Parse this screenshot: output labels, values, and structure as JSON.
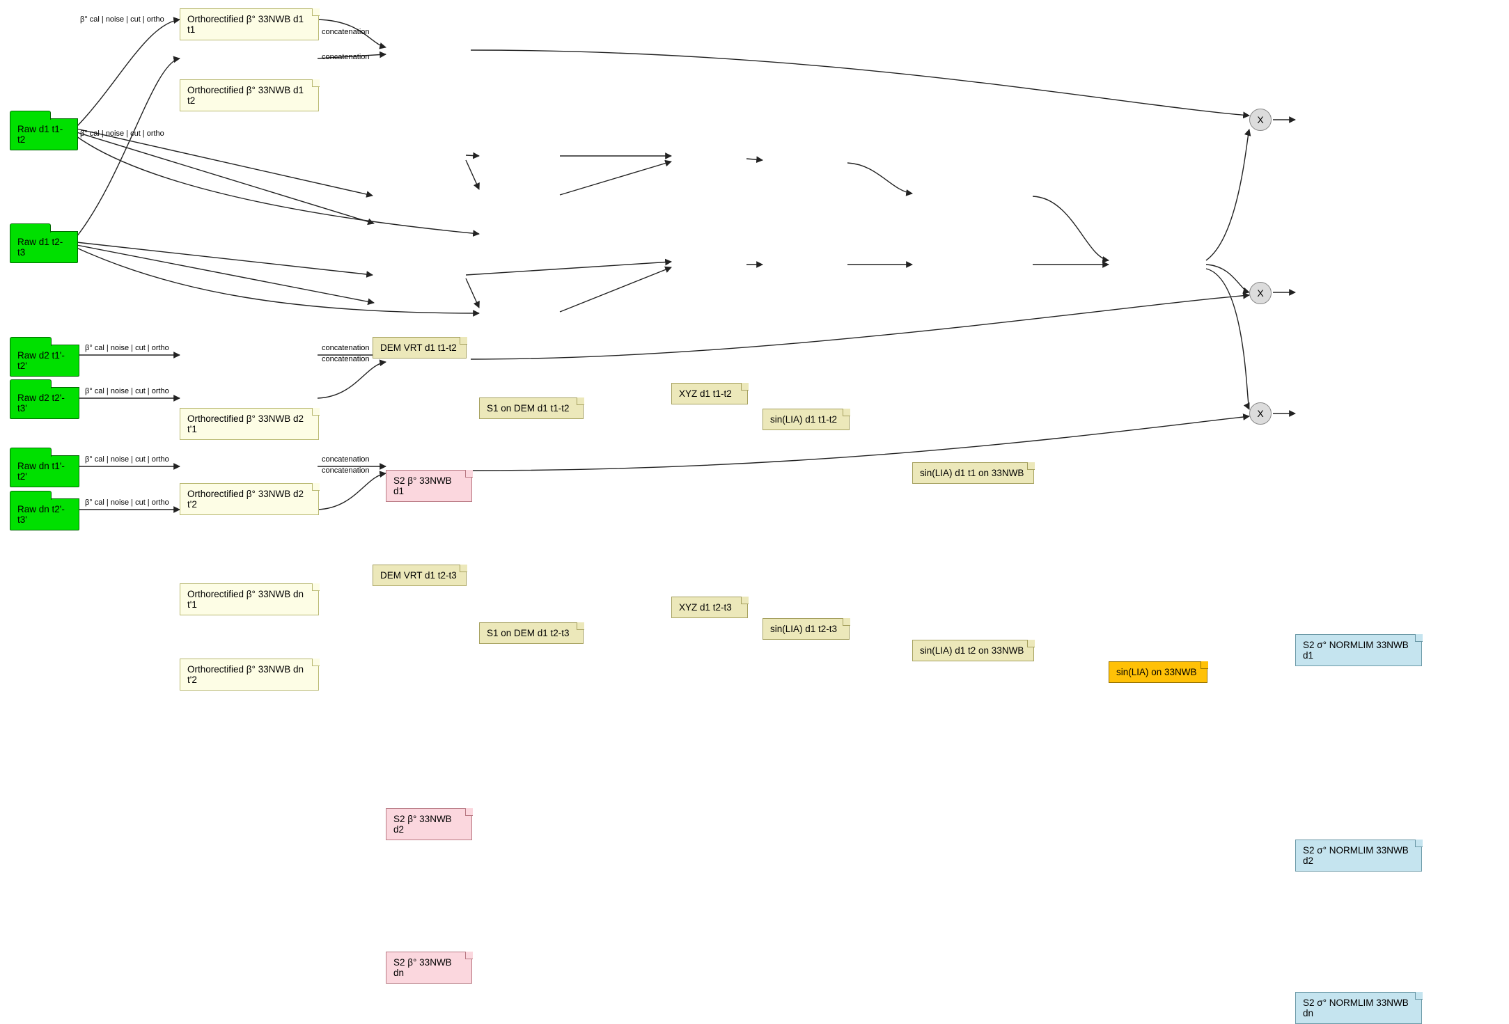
{
  "folders": {
    "raw_d1_t1t2": "Raw d1 t1-t2",
    "raw_d1_t2t3": "Raw d1 t2-t3",
    "raw_d2_t1t2": "Raw d2 t1'-t2'",
    "raw_d2_t2t3": "Raw d2 t2'-t3'",
    "raw_dn_t1t2": "Raw dn t1'-t2'",
    "raw_dn_t2t3": "Raw dn t2'-t3'"
  },
  "notes": {
    "ortho_d1_t1": "Orthorectified β° 33NWB d1 t1",
    "ortho_d1_t2": "Orthorectified β° 33NWB d1 t2",
    "dem_vrt_d1": "DEM VRT d1 t1-t2",
    "s1dem_d1": "S1 on DEM d1 t1-t2",
    "xyz_d1": "XYZ d1 t1-t2",
    "sinlia_d1": "sin(LIA) d1 t1-t2",
    "sinlia_d1_on": "sin(LIA) d1 t1 on 33NWB",
    "dem_vrt_d1b": "DEM VRT d1 t2-t3",
    "s1dem_d1b": "S1 on DEM d1 t2-t3",
    "xyz_d1b": "XYZ d1 t2-t3",
    "sinlia_d1b": "sin(LIA) d1 t2-t3",
    "sinlia_d1b_on": "sin(LIA) d1 t2 on 33NWB",
    "sinlia_gold": "sin(LIA) on 33NWB",
    "s2_d1": "S2 β° 33NWB d1",
    "ortho_d2_t1": "Orthorectified β° 33NWB d2 t'1",
    "ortho_d2_t2": "Orthorectified β° 33NWB d2 t'2",
    "s2_d2": "S2 β° 33NWB d2",
    "ortho_dn_t1": "Orthorectified β° 33NWB dn t'1",
    "ortho_dn_t2": "Orthorectified β° 33NWB dn t'2",
    "s2_dn": "S2 β° 33NWB dn",
    "out_d1": "S2 σ° NORMLIM 33NWB d1",
    "out_d2": "S2 σ° NORMLIM 33NWB d2",
    "out_dn": "S2 σ° NORMLIM 33NWB dn"
  },
  "circle": "X",
  "edge_labels": {
    "beta_chain": "β° cal | noise | cut | ortho",
    "concat": "concatenation"
  }
}
